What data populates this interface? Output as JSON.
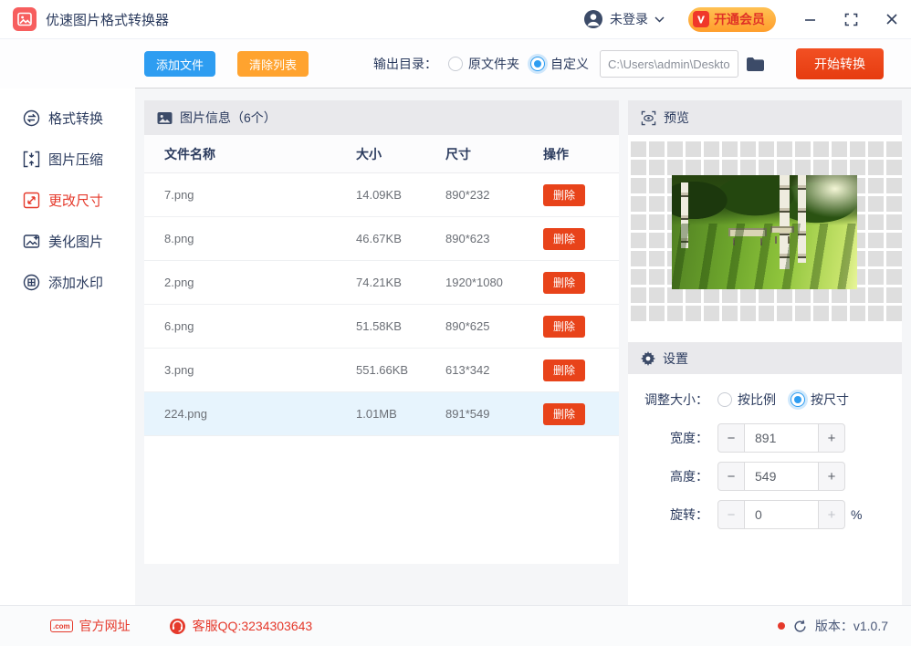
{
  "titlebar": {
    "app_title": "优速图片格式转换器",
    "login_label": "未登录",
    "vip_button": "开通会员"
  },
  "toolbar": {
    "add_files": "添加文件",
    "clear_list": "清除列表",
    "output_dir_label": "输出目录：",
    "radio_original": "原文件夹",
    "radio_custom": "自定义",
    "path_value": "C:\\Users\\admin\\Deskto",
    "start_convert": "开始转换"
  },
  "sidebar": {
    "items": [
      {
        "label": "格式转换"
      },
      {
        "label": "图片压缩"
      },
      {
        "label": "更改尺寸"
      },
      {
        "label": "美化图片"
      },
      {
        "label": "添加水印"
      }
    ]
  },
  "table": {
    "title": "图片信息（6个）",
    "columns": [
      "文件名称",
      "大小",
      "尺寸",
      "操作"
    ],
    "delete_label": "删除",
    "rows": [
      {
        "name": "7.png",
        "size": "14.09KB",
        "dims": "890*232"
      },
      {
        "name": "8.png",
        "size": "46.67KB",
        "dims": "890*623"
      },
      {
        "name": "2.png",
        "size": "74.21KB",
        "dims": "1920*1080"
      },
      {
        "name": "6.png",
        "size": "51.58KB",
        "dims": "890*625"
      },
      {
        "name": "3.png",
        "size": "551.66KB",
        "dims": "613*342"
      },
      {
        "name": "224.png",
        "size": "1.01MB",
        "dims": "891*549"
      }
    ]
  },
  "preview": {
    "title": "预览"
  },
  "settings": {
    "title": "设置",
    "resize_label": "调整大小：",
    "radio_ratio": "按比例",
    "radio_size": "按尺寸",
    "width_label": "宽度：",
    "width_value": "891",
    "height_label": "高度：",
    "height_value": "549",
    "rotate_label": "旋转：",
    "rotate_value": "0",
    "rotate_suffix": "%",
    "minus_glyph": "−",
    "plus_glyph": "+"
  },
  "footer": {
    "com_badge": ".com",
    "website": "官方网址",
    "qq": "客服QQ:3234303643",
    "version": "版本：v1.0.7"
  },
  "colors": {
    "accent_blue": "#2e9df1",
    "accent_orange": "#ffa32f",
    "accent_red": "#e8431a",
    "brand_red": "#f75e5e",
    "sidebar_active": "#e5392b",
    "selected_row": "#e7f4fd",
    "panel_header": "#e9e9ec"
  }
}
